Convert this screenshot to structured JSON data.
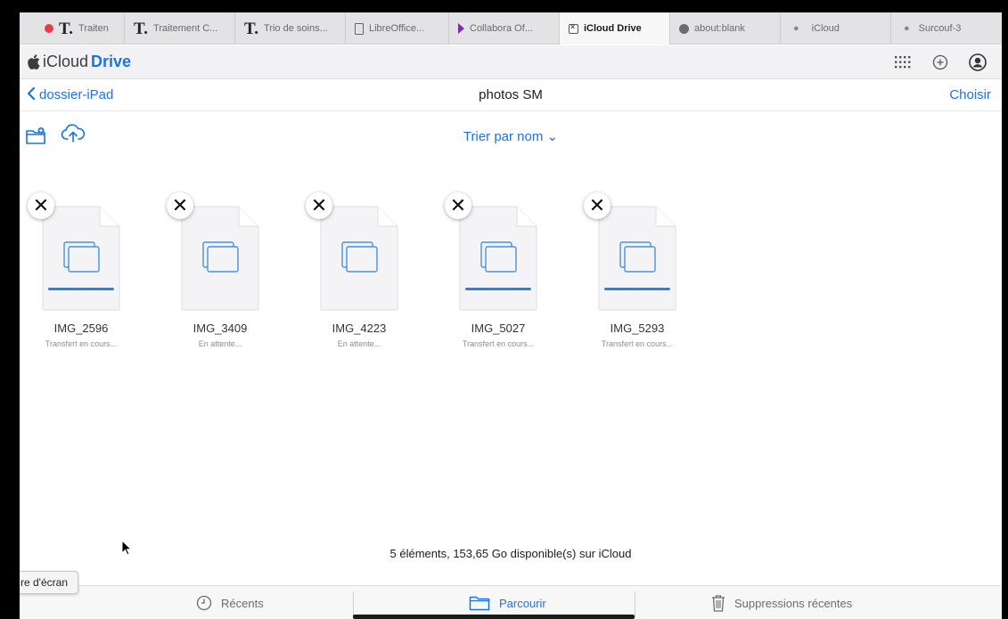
{
  "browser": {
    "tabs": [
      {
        "icon": "T",
        "label": "Traiten"
      },
      {
        "icon": "T",
        "label": "Traitement C..."
      },
      {
        "icon": "T",
        "label": "Trio de soins..."
      },
      {
        "icon": "doc",
        "label": "LibreOffice..."
      },
      {
        "icon": "arrow",
        "label": "Collabora Of..."
      },
      {
        "icon": "box",
        "label": "iCloud Drive",
        "active": true
      },
      {
        "icon": "compass",
        "label": "about:blank"
      },
      {
        "icon": "apple",
        "label": "iCloud"
      },
      {
        "icon": "apple",
        "label": "Surcouf-3"
      }
    ]
  },
  "app": {
    "brand_prefix": "iCloud",
    "brand_suffix": "Drive"
  },
  "nav": {
    "back_label": "dossier-iPad",
    "title": "photos SM",
    "choose_label": "Choisir"
  },
  "toolbar": {
    "sort_label": "Trier par nom"
  },
  "files": [
    {
      "name": "IMG_2596",
      "status": "Transfert en cours...",
      "progress": 1.0
    },
    {
      "name": "IMG_3409",
      "status": "En attente...",
      "progress": null
    },
    {
      "name": "IMG_4223",
      "status": "En attente...",
      "progress": null
    },
    {
      "name": "IMG_5027",
      "status": "Transfert en cours...",
      "progress": 1.0
    },
    {
      "name": "IMG_5293",
      "status": "Transfert en cours...",
      "progress": 1.0
    }
  ],
  "footer": {
    "info": "5 éléments, 153,65 Go disponible(s) sur iCloud"
  },
  "tooltip": {
    "text": "re d'écran"
  },
  "bottom_tabs": {
    "recents": "Récents",
    "browse": "Parcourir",
    "deleted": "Suppressions récentes"
  },
  "colors": {
    "accent": "#1a73e8",
    "progress": "#2f7fe0"
  }
}
